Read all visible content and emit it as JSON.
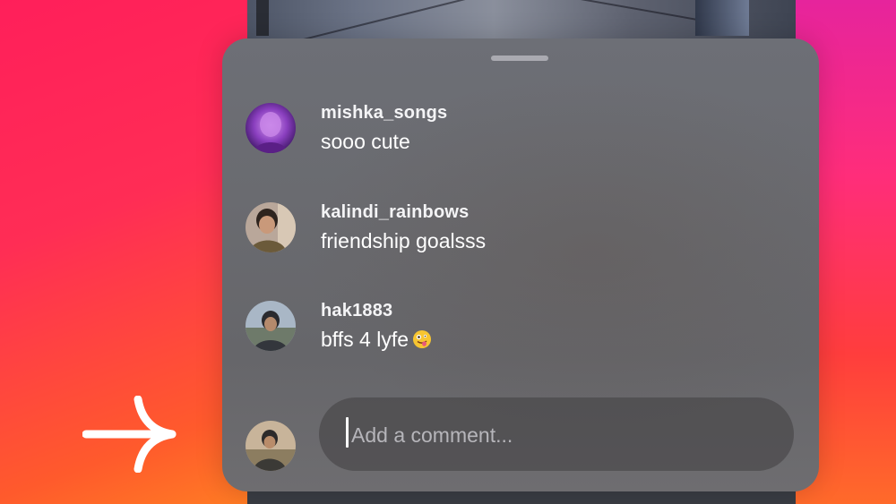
{
  "comments": [
    {
      "username": "mishka_songs",
      "text": "sooo cute",
      "avatar": "purple-portrait-avatar"
    },
    {
      "username": "kalindi_rainbows",
      "text": "friendship goalsss",
      "avatar": "smiling-person-avatar"
    },
    {
      "username": "hak1883",
      "text": "bffs 4 lyfe",
      "emoji": "zany-face-emoji",
      "avatar": "outdoor-person-avatar"
    }
  ],
  "composer": {
    "placeholder": "Add a comment...",
    "avatar": "current-user-avatar"
  },
  "icons": {
    "arrow": "right-arrow-icon"
  },
  "colors": {
    "gradient_top": "#ff1f5a",
    "gradient_bottom": "#ffc21a",
    "sheet": "#6a6b70",
    "text": "#ffffff"
  }
}
